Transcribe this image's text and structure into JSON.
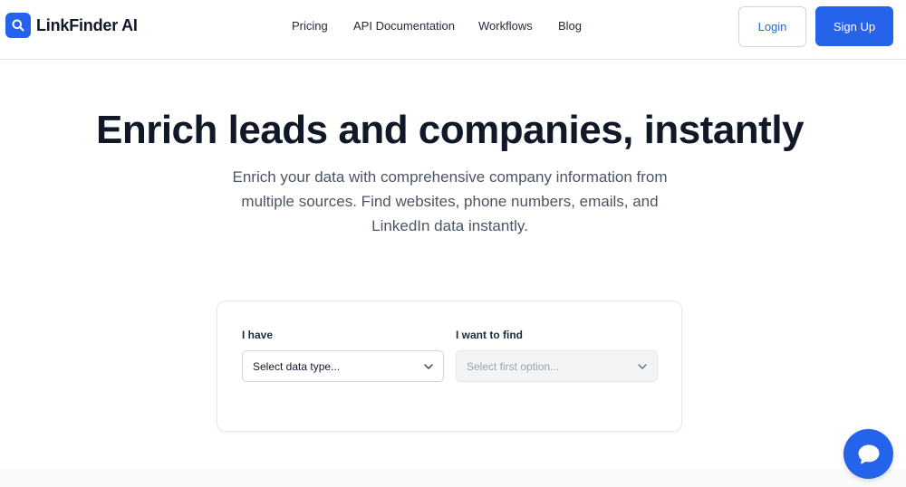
{
  "brand": {
    "name": "LinkFinder AI",
    "icon": "search-icon",
    "accent": "#2563eb"
  },
  "nav": [
    {
      "label": "Pricing"
    },
    {
      "label": "API Documentation"
    },
    {
      "label": "Workflows"
    },
    {
      "label": "Blog"
    }
  ],
  "auth": {
    "login": "Login",
    "signup": "Sign Up"
  },
  "hero": {
    "title": "Enrich leads and companies, instantly",
    "subtitle": "Enrich your data with comprehensive company information from multiple sources. Find websites, phone numbers, emails, and LinkedIn data instantly."
  },
  "form": {
    "have": {
      "label": "I have",
      "value": "Select data type..."
    },
    "find": {
      "label": "I want to find",
      "value": "Select first option..."
    }
  },
  "chat": {
    "icon": "chat-bubble-icon"
  }
}
